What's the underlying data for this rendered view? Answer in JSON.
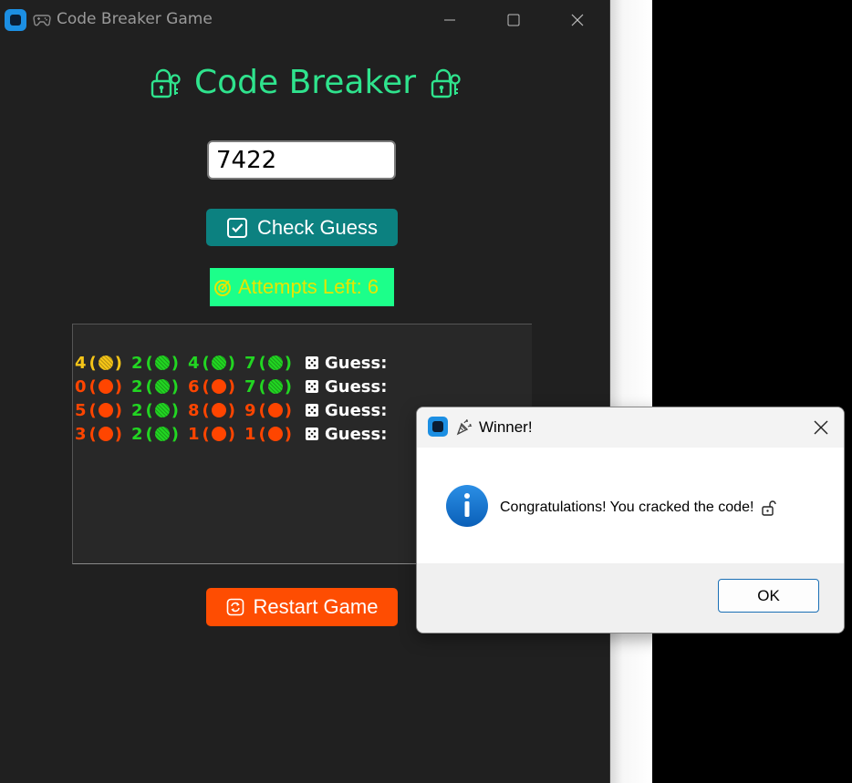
{
  "window": {
    "title": "Code Breaker Game"
  },
  "app": {
    "heading": "Code Breaker",
    "guess_value": "7422",
    "check_button": "Check Guess",
    "attempts_label": "Attempts Left: 6",
    "restart_button": "Restart Game",
    "history": [
      {
        "digits": [
          {
            "d": "4",
            "status": "yellow"
          },
          {
            "d": "2",
            "status": "green"
          },
          {
            "d": "4",
            "status": "green"
          },
          {
            "d": "7",
            "status": "green"
          }
        ],
        "label": "Guess:"
      },
      {
        "digits": [
          {
            "d": "0",
            "status": "red"
          },
          {
            "d": "2",
            "status": "green"
          },
          {
            "d": "6",
            "status": "red"
          },
          {
            "d": "7",
            "status": "green"
          }
        ],
        "label": "Guess:"
      },
      {
        "digits": [
          {
            "d": "5",
            "status": "red"
          },
          {
            "d": "2",
            "status": "green"
          },
          {
            "d": "8",
            "status": "red"
          },
          {
            "d": "9",
            "status": "red"
          }
        ],
        "label": "Guess:"
      },
      {
        "digits": [
          {
            "d": "3",
            "status": "red"
          },
          {
            "d": "2",
            "status": "green"
          },
          {
            "d": "1",
            "status": "red"
          },
          {
            "d": "1",
            "status": "red"
          }
        ],
        "label": "Guess:"
      }
    ]
  },
  "dialog": {
    "title": "Winner!",
    "message": "Congratulations! You cracked the code!",
    "ok_button": "OK"
  },
  "colors": {
    "accent_green": "#2fe38d",
    "teal_button": "#0c8180",
    "orange_button": "#fe4d02",
    "attempts_bg": "#1cff8a",
    "attempts_text": "#e6e600",
    "status_green": "#22d622",
    "status_yellow": "#f5c518",
    "status_red": "#ff4500"
  }
}
